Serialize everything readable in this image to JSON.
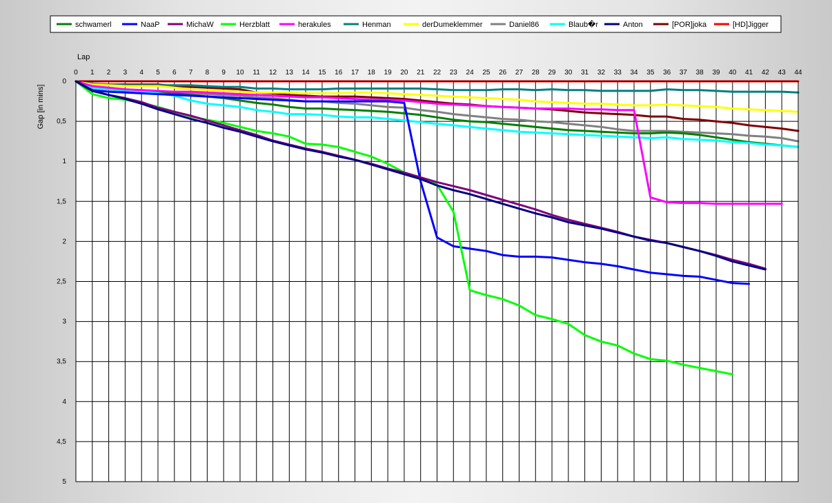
{
  "chart_data": {
    "type": "line",
    "title": "",
    "xlabel": "Lap",
    "ylabel": "Gap [in mins]",
    "xlim": [
      0,
      44
    ],
    "ylim": [
      0,
      5
    ],
    "y_inverted": true,
    "grid": true,
    "legend_position": "top",
    "x_ticks": [
      "0",
      "1",
      "2",
      "3",
      "4",
      "5",
      "6",
      "7",
      "8",
      "9",
      "10",
      "11",
      "12",
      "13",
      "14",
      "15",
      "16",
      "17",
      "18",
      "19",
      "20",
      "21",
      "22",
      "23",
      "24",
      "25",
      "26",
      "27",
      "28",
      "29",
      "30",
      "31",
      "32",
      "33",
      "34",
      "35",
      "36",
      "37",
      "38",
      "39",
      "40",
      "41",
      "42",
      "43",
      "44"
    ],
    "y_ticks": [
      {
        "value": 0,
        "label": "0"
      },
      {
        "value": 0.5,
        "label": "0,5"
      },
      {
        "value": 1,
        "label": "1"
      },
      {
        "value": 1.5,
        "label": "1,5"
      },
      {
        "value": 2,
        "label": "2"
      },
      {
        "value": 2.5,
        "label": "2,5"
      },
      {
        "value": 3,
        "label": "3"
      },
      {
        "value": 3.5,
        "label": "3,5"
      },
      {
        "value": 4,
        "label": "4"
      },
      {
        "value": 4.5,
        "label": "4,5"
      },
      {
        "value": 5,
        "label": "5"
      }
    ],
    "series": [
      {
        "name": "[HD]Jigger",
        "color": "#ff0000",
        "values": [
          0,
          0,
          0,
          0,
          0,
          0,
          0,
          0,
          0,
          0,
          0,
          0,
          0,
          0,
          0,
          0,
          0,
          0,
          0,
          0,
          0,
          0,
          0,
          0,
          0,
          0,
          0,
          0,
          0,
          0,
          0,
          0,
          0,
          0,
          0,
          0,
          0,
          0,
          0,
          0,
          0,
          0,
          0,
          0,
          0
        ]
      },
      {
        "name": "[POR]joka",
        "color": "#800000",
        "values": [
          0,
          0.04,
          0.04,
          0.04,
          0.04,
          0.04,
          0.06,
          0.07,
          0.08,
          0.09,
          0.1,
          0.14,
          0.15,
          0.17,
          0.18,
          0.19,
          0.19,
          0.19,
          0.2,
          0.21,
          0.22,
          0.24,
          0.26,
          0.28,
          0.29,
          0.31,
          0.32,
          0.33,
          0.34,
          0.35,
          0.37,
          0.39,
          0.4,
          0.41,
          0.42,
          0.44,
          0.44,
          0.47,
          0.48,
          0.5,
          0.52,
          0.55,
          0.57,
          0.59,
          0.62
        ]
      },
      {
        "name": "Henman",
        "color": "#008080",
        "values": [
          0,
          0.03,
          0.04,
          0.05,
          0.05,
          0.05,
          0.05,
          0.05,
          0.06,
          0.07,
          0.07,
          0.09,
          0.09,
          0.1,
          0.1,
          0.1,
          0.09,
          0.09,
          0.09,
          0.09,
          0.09,
          0.09,
          0.1,
          0.11,
          0.11,
          0.11,
          0.1,
          0.1,
          0.11,
          0.1,
          0.11,
          0.11,
          0.12,
          0.12,
          0.12,
          0.12,
          0.1,
          0.11,
          0.11,
          0.12,
          0.13,
          0.13,
          0.13,
          0.13,
          0.14
        ]
      },
      {
        "name": "derDumeklemmer",
        "color": "#ffff00",
        "values": [
          0,
          0.04,
          0.05,
          0.06,
          0.06,
          0.06,
          0.08,
          0.1,
          0.11,
          0.12,
          0.13,
          0.14,
          0.14,
          0.14,
          0.15,
          0.15,
          0.15,
          0.14,
          0.14,
          0.15,
          0.16,
          0.17,
          0.18,
          0.19,
          0.2,
          0.21,
          0.22,
          0.23,
          0.25,
          0.26,
          0.27,
          0.28,
          0.28,
          0.29,
          0.3,
          0.3,
          0.29,
          0.3,
          0.31,
          0.32,
          0.34,
          0.35,
          0.36,
          0.37,
          0.38
        ]
      },
      {
        "name": "Daniel86",
        "color": "#808080",
        "values": [
          0,
          0.07,
          0.1,
          0.11,
          0.12,
          0.13,
          0.14,
          0.15,
          0.16,
          0.17,
          0.18,
          0.2,
          0.21,
          0.23,
          0.25,
          0.25,
          0.27,
          0.28,
          0.3,
          0.32,
          0.33,
          0.36,
          0.38,
          0.41,
          0.43,
          0.45,
          0.47,
          0.48,
          0.5,
          0.51,
          0.53,
          0.55,
          0.57,
          0.6,
          0.62,
          0.62,
          0.62,
          0.63,
          0.64,
          0.65,
          0.66,
          0.68,
          0.69,
          0.71,
          0.75
        ]
      },
      {
        "name": "schwamerl",
        "color": "#008000",
        "values": [
          0,
          0.08,
          0.1,
          0.12,
          0.13,
          0.14,
          0.15,
          0.17,
          0.19,
          0.21,
          0.24,
          0.27,
          0.29,
          0.32,
          0.34,
          0.34,
          0.35,
          0.36,
          0.37,
          0.38,
          0.4,
          0.42,
          0.45,
          0.48,
          0.5,
          0.51,
          0.53,
          0.55,
          0.57,
          0.59,
          0.61,
          0.62,
          0.63,
          0.64,
          0.65,
          0.65,
          0.64,
          0.65,
          0.67,
          0.7,
          0.73,
          0.76,
          0.78,
          0.8,
          0.82
        ]
      },
      {
        "name": "Blaub�r",
        "color": "#00ffff",
        "values": [
          0,
          0.08,
          0.1,
          0.11,
          0.13,
          0.15,
          0.18,
          0.24,
          0.28,
          0.3,
          0.32,
          0.36,
          0.38,
          0.41,
          0.41,
          0.42,
          0.44,
          0.45,
          0.45,
          0.47,
          0.49,
          0.51,
          0.53,
          0.55,
          0.57,
          0.59,
          0.61,
          0.63,
          0.64,
          0.65,
          0.66,
          0.67,
          0.68,
          0.69,
          0.7,
          0.71,
          0.7,
          0.72,
          0.73,
          0.74,
          0.76,
          0.77,
          0.79,
          0.8,
          0.82
        ]
      },
      {
        "name": "herakules",
        "color": "#ff00ff",
        "values": [
          0,
          0.06,
          0.08,
          0.1,
          0.11,
          0.12,
          0.13,
          0.13,
          0.14,
          0.15,
          0.16,
          0.17,
          0.18,
          0.19,
          0.2,
          0.2,
          0.21,
          0.22,
          0.23,
          0.23,
          0.24,
          0.26,
          0.28,
          0.29,
          0.3,
          0.31,
          0.32,
          0.33,
          0.34,
          0.34,
          0.34,
          0.35,
          0.35,
          0.36,
          0.36,
          1.45,
          1.51,
          1.52,
          1.52,
          1.53,
          1.53,
          1.53,
          1.53,
          1.53,
          null
        ]
      },
      {
        "name": "NaaP",
        "color": "#0000ff",
        "values": [
          0,
          0.11,
          0.13,
          0.14,
          0.15,
          0.16,
          0.17,
          0.18,
          0.19,
          0.2,
          0.21,
          0.22,
          0.23,
          0.24,
          0.25,
          0.25,
          0.25,
          0.25,
          0.25,
          0.25,
          0.27,
          1.25,
          1.95,
          2.06,
          2.09,
          2.12,
          2.17,
          2.19,
          2.19,
          2.2,
          2.23,
          2.26,
          2.28,
          2.31,
          2.35,
          2.39,
          2.41,
          2.43,
          2.44,
          2.48,
          2.52,
          2.53,
          null,
          null,
          null
        ]
      },
      {
        "name": "Herzblatt",
        "color": "#00ff00",
        "values": [
          0,
          0.16,
          0.21,
          0.23,
          0.27,
          0.32,
          0.38,
          0.44,
          0.48,
          0.52,
          0.57,
          0.62,
          0.65,
          0.69,
          0.78,
          0.79,
          0.82,
          0.88,
          0.94,
          1.03,
          1.14,
          1.2,
          1.29,
          1.63,
          2.61,
          2.67,
          2.72,
          2.8,
          2.92,
          2.97,
          3.03,
          3.17,
          3.25,
          3.3,
          3.4,
          3.47,
          3.49,
          3.54,
          3.58,
          3.62,
          3.66,
          null,
          null,
          null,
          null
        ]
      },
      {
        "name": "MichaW",
        "color": "#800080",
        "values": [
          0,
          0.12,
          0.17,
          0.21,
          0.26,
          0.33,
          0.38,
          0.43,
          0.49,
          0.55,
          0.61,
          0.67,
          0.74,
          0.79,
          0.84,
          0.88,
          0.93,
          0.98,
          1.03,
          1.09,
          1.14,
          1.2,
          1.26,
          1.31,
          1.36,
          1.42,
          1.48,
          1.54,
          1.6,
          1.67,
          1.73,
          1.78,
          1.83,
          1.88,
          1.94,
          1.98,
          2.02,
          2.07,
          2.12,
          2.17,
          2.23,
          2.28,
          2.34,
          null,
          null
        ]
      },
      {
        "name": "Anton",
        "color": "#000080",
        "values": [
          0,
          0.12,
          0.17,
          0.22,
          0.28,
          0.35,
          0.41,
          0.47,
          0.52,
          0.58,
          0.63,
          0.69,
          0.75,
          0.8,
          0.85,
          0.89,
          0.94,
          0.98,
          1.04,
          1.1,
          1.16,
          1.22,
          1.3,
          1.36,
          1.41,
          1.47,
          1.53,
          1.59,
          1.65,
          1.7,
          1.76,
          1.8,
          1.84,
          1.89,
          1.94,
          1.99,
          2.02,
          2.07,
          2.12,
          2.18,
          2.25,
          2.3,
          2.35,
          null,
          null
        ]
      }
    ],
    "legend_order": [
      "schwamerl",
      "NaaP",
      "MichaW",
      "Herzblatt",
      "herakules",
      "Henman",
      "derDumeklemmer",
      "Daniel86",
      "Blaub�r",
      "Anton",
      "[POR]joka",
      "[HD]Jigger"
    ]
  }
}
